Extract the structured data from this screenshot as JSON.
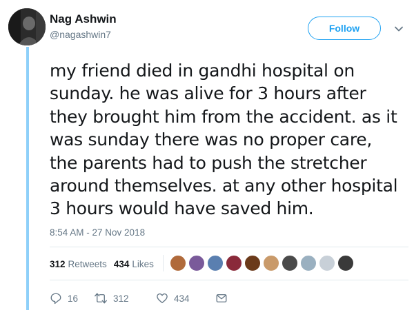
{
  "author": {
    "name": "Nag Ashwin",
    "handle": "@nagashwin7"
  },
  "follow_label": "Follow",
  "tweet": {
    "text": "my friend died in gandhi hospital on\nsunday. he was alive for 3 hours after\nthey brought him from the accident. as it\nwas sunday there was no proper care,\nthe parents had to push the stretcher\naround themselves. at any other hospital\n3 hours would have saved him.",
    "timestamp": "8:54 AM - 27 Nov 2018"
  },
  "stats": {
    "retweets_count": "312",
    "retweets_label": "Retweets",
    "likes_count": "434",
    "likes_label": "Likes"
  },
  "liker_avatars": [
    "#b06a3b",
    "#7a5a9a",
    "#5a7fb0",
    "#8a2a3a",
    "#6b3a1a",
    "#c99a6a",
    "#4a4a4a",
    "#9ab0c0",
    "#c8d0d8",
    "#3a3a3a"
  ],
  "actions": {
    "reply_count": "16",
    "retweet_count": "312",
    "like_count": "434"
  },
  "colors": {
    "accent": "#1da1f2",
    "thread_line": "#8ed0f9",
    "secondary_text": "#657786"
  }
}
